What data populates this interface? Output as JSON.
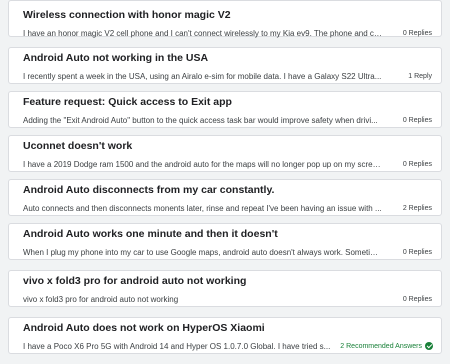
{
  "threads": [
    {
      "title": "Wireless connection with honor magic V2",
      "snippet": "I have an honor magic V2 cell phone and I can't connect wirelessly to my Kia ev9. The phone and ca...",
      "replies": "0 Replies"
    },
    {
      "title": "Android Auto not working in the USA",
      "snippet": "I recently spent a week in the USA, using an Airalo e-sim for mobile data. I have a Galaxy S22 Ultra...",
      "replies": "1 Reply"
    },
    {
      "title": "Feature request: Quick access to Exit app",
      "snippet": "Adding the \"Exit Android Auto\" button to the quick access task bar would improve safety when drivi...",
      "replies": "0 Replies"
    },
    {
      "title": "Uconnet doesn't work",
      "snippet": "I have a 2019 Dodge ram 1500 and the android auto for the maps will no longer pop up on my scree...",
      "replies": "0 Replies"
    },
    {
      "title": "Android Auto disconnects from my car constantly.",
      "snippet": "Auto connects and then disconnects monents later, rinse and repeat I've been having an issue with ...",
      "replies": "2 Replies"
    },
    {
      "title": "Android Auto works one minute and then it doesn't",
      "snippet": "When I plug my phone into my car to use Google maps, android auto doesn't always work. Sometim...",
      "replies": "0 Replies"
    },
    {
      "title": "vivo x fold3 pro for android auto not working",
      "snippet": "vivo x fold3 pro for android auto not working",
      "replies": "0 Replies"
    },
    {
      "title": "Android Auto does not work on HyperOS Xiaomi",
      "snippet": "I have a Poco X6 Pro 5G with Android 14 and Hyper OS 1.0.7.0 Global. I have tried s...",
      "replies": "2 Recommended Answers",
      "icon": "check-circle-icon",
      "accent": "#188038"
    }
  ]
}
